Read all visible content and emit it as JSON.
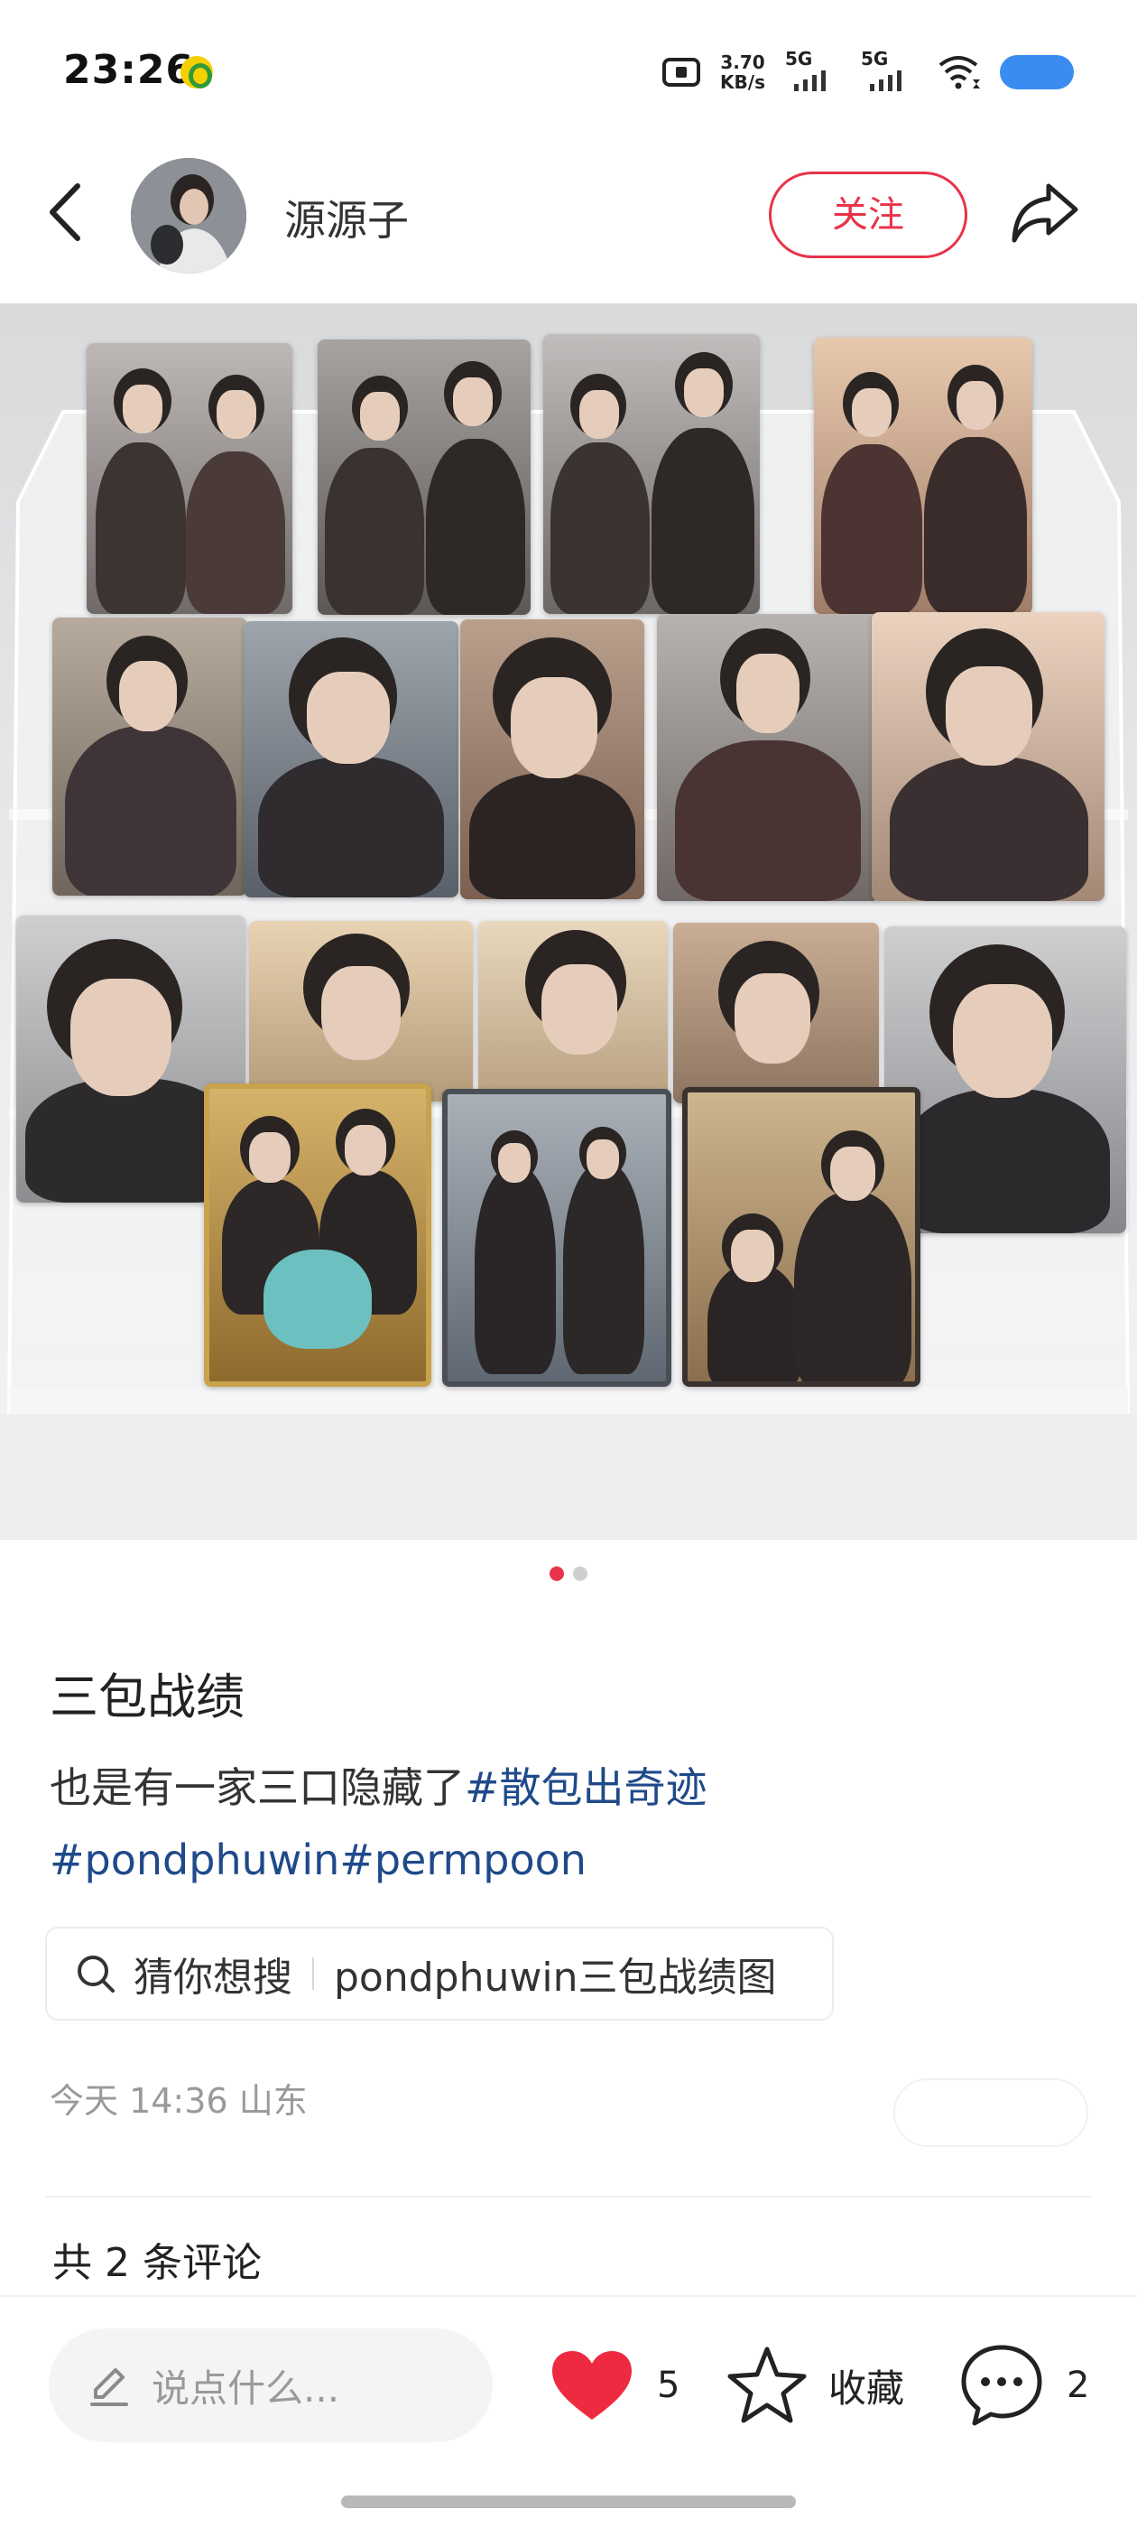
{
  "status_bar": {
    "time": "23:26",
    "network_speed_value": "3.70",
    "network_speed_unit": "KB/s",
    "signal1_label": "5G",
    "signal2_label": "5G",
    "icons": [
      "music-app-icon",
      "screen-record-icon",
      "wifi-icon",
      "battery-icon"
    ],
    "battery_color": "#3a8cf0"
  },
  "header": {
    "username": "源源子",
    "follow_label": "关注",
    "accent_color": "#e8334a"
  },
  "gallery": {
    "image_count": 2,
    "active_index": 0
  },
  "post": {
    "title": "三包战绩",
    "body_text": "也是有一家三口隐藏了",
    "hashtags": [
      "#散包出奇迹",
      "#pondphuwin",
      "#permpoon"
    ],
    "hashtag_color": "#1f4a8a"
  },
  "search_suggestion": {
    "lead": "猜你想搜",
    "query": "pondphuwin三包战绩图"
  },
  "meta": {
    "date": "今天 14:36",
    "location": "山东"
  },
  "comments": {
    "count_label": "共 2 条评论"
  },
  "bottom_bar": {
    "input_placeholder": "说点什么...",
    "likes": "5",
    "favorite_label": "收藏",
    "comment_count": "2"
  }
}
